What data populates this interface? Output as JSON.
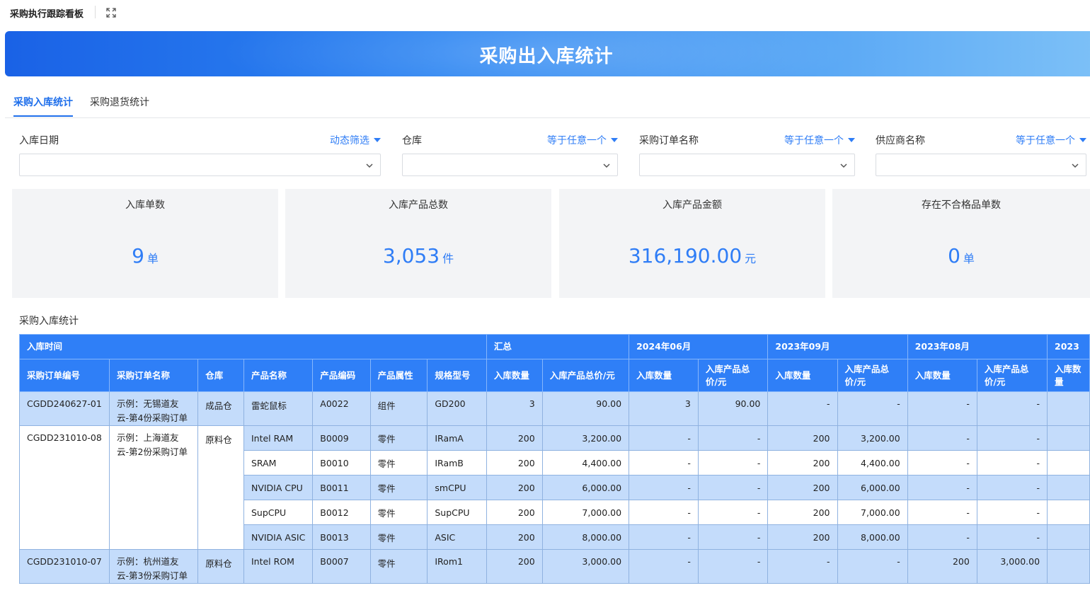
{
  "app": {
    "title": "采购执行跟踪看板"
  },
  "banner": {
    "title": "采购出入库统计"
  },
  "tabs": [
    {
      "label": "采购入库统计",
      "active": true
    },
    {
      "label": "采购退货统计",
      "active": false
    }
  ],
  "filters": [
    {
      "label": "入库日期",
      "mode": "动态筛选",
      "value": ""
    },
    {
      "label": "仓库",
      "mode": "等于任意一个",
      "value": ""
    },
    {
      "label": "采购订单名称",
      "mode": "等于任意一个",
      "value": ""
    },
    {
      "label": "供应商名称",
      "mode": "等于任意一个",
      "value": ""
    }
  ],
  "kpis": [
    {
      "label": "入库单数",
      "value": "9",
      "unit": "单"
    },
    {
      "label": "入库产品总数",
      "value": "3,053",
      "unit": "件"
    },
    {
      "label": "入库产品金额",
      "value": "316,190.00",
      "unit": "元"
    },
    {
      "label": "存在不合格品单数",
      "value": "0",
      "unit": "单"
    }
  ],
  "table": {
    "section_title": "采购入库统计",
    "group_row": {
      "first": "入库时间",
      "groups": [
        "汇总",
        "2024年06月",
        "2023年09月",
        "2023年08月",
        "2023"
      ]
    },
    "columns": [
      "采购订单编号",
      "采购订单名称",
      "仓库",
      "产品名称",
      "产品编码",
      "产品属性",
      "规格型号"
    ],
    "measure_cols": [
      "入库数量",
      "入库产品总价/元"
    ],
    "orders": [
      {
        "order_no": "CGDD240627-01",
        "order_name": "示例：无锡道友云-第4份采购订单",
        "warehouse": "成品仓",
        "items": [
          {
            "name": "雷蛇鼠标",
            "code": "A0022",
            "attr": "组件",
            "spec": "GD200",
            "values": [
              "3",
              "90.00",
              "3",
              "90.00",
              "-",
              "-",
              "-",
              "-"
            ]
          }
        ]
      },
      {
        "order_no": "CGDD231010-08",
        "order_name": "示例：上海道友云-第2份采购订单",
        "warehouse": "原料仓",
        "items": [
          {
            "name": "Intel RAM",
            "code": "B0009",
            "attr": "零件",
            "spec": "IRamA",
            "values": [
              "200",
              "3,200.00",
              "-",
              "-",
              "200",
              "3,200.00",
              "-",
              "-"
            ]
          },
          {
            "name": "SRAM",
            "code": "B0010",
            "attr": "零件",
            "spec": "IRamB",
            "values": [
              "200",
              "4,400.00",
              "-",
              "-",
              "200",
              "4,400.00",
              "-",
              "-"
            ]
          },
          {
            "name": "NVIDIA CPU",
            "code": "B0011",
            "attr": "零件",
            "spec": "smCPU",
            "values": [
              "200",
              "6,000.00",
              "-",
              "-",
              "200",
              "6,000.00",
              "-",
              "-"
            ]
          },
          {
            "name": "SupCPU",
            "code": "B0012",
            "attr": "零件",
            "spec": "SupCPU",
            "values": [
              "200",
              "7,000.00",
              "-",
              "-",
              "200",
              "7,000.00",
              "-",
              "-"
            ]
          },
          {
            "name": "NVIDIA ASIC",
            "code": "B0013",
            "attr": "零件",
            "spec": "ASIC",
            "values": [
              "200",
              "8,000.00",
              "-",
              "-",
              "200",
              "8,000.00",
              "-",
              "-"
            ]
          }
        ]
      },
      {
        "order_no": "CGDD231010-07",
        "order_name": "示例：杭州道友云-第3份采购订单",
        "warehouse": "原料仓",
        "items": [
          {
            "name": "Intel ROM",
            "code": "B0007",
            "attr": "零件",
            "spec": "IRom1",
            "values": [
              "200",
              "3,000.00",
              "-",
              "-",
              "-",
              "-",
              "200",
              "3,000.00"
            ]
          }
        ]
      }
    ]
  }
}
